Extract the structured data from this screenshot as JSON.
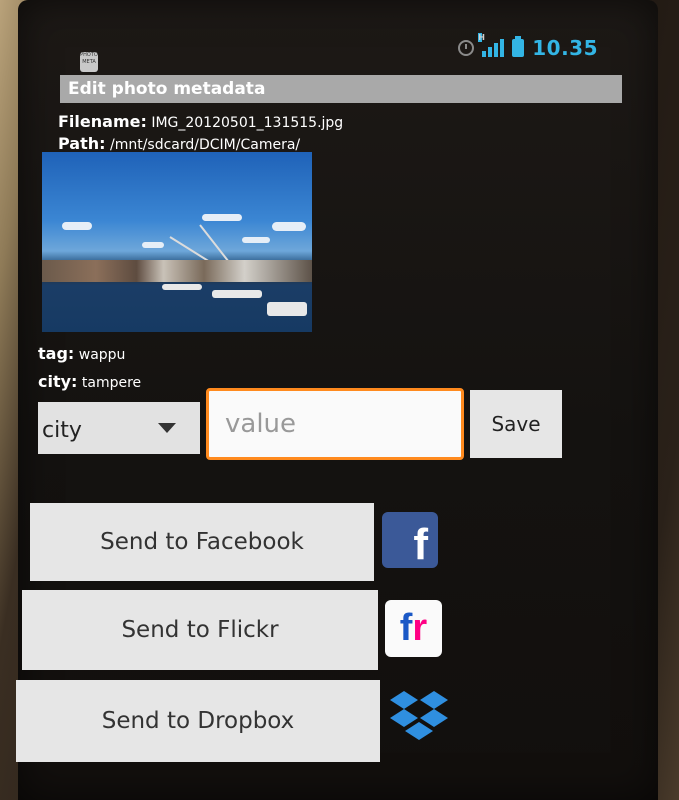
{
  "status_bar": {
    "app_icon_text": "PHOTO META",
    "network_label": "H",
    "time": "10.35"
  },
  "header": {
    "title": "Edit photo metadata"
  },
  "file_info": {
    "filename_label": "Filename:",
    "filename_value": "IMG_20120501_131515.jpg",
    "path_label": "Path:",
    "path_value": "/mnt/sdcard/DCIM/Camera/"
  },
  "metadata": [
    {
      "key_label": "tag:",
      "value": "wappu"
    },
    {
      "key_label": "city:",
      "value": "tampere"
    }
  ],
  "editor": {
    "selected_field": "city",
    "value_placeholder": "value",
    "save_label": "Save"
  },
  "share": {
    "facebook_label": "Send to Facebook",
    "flickr_label": "Send to Flickr",
    "dropbox_label": "Send to Dropbox",
    "facebook_icon": "facebook-icon",
    "flickr_icon": "flickr-icon",
    "dropbox_icon": "dropbox-icon",
    "flickr_icon_f": "f",
    "flickr_icon_r": "r",
    "facebook_icon_glyph": "f"
  },
  "colors": {
    "accent": "#33b5e5",
    "input_focus": "#ff8a1e",
    "title_bar": "#a9a9a9"
  }
}
